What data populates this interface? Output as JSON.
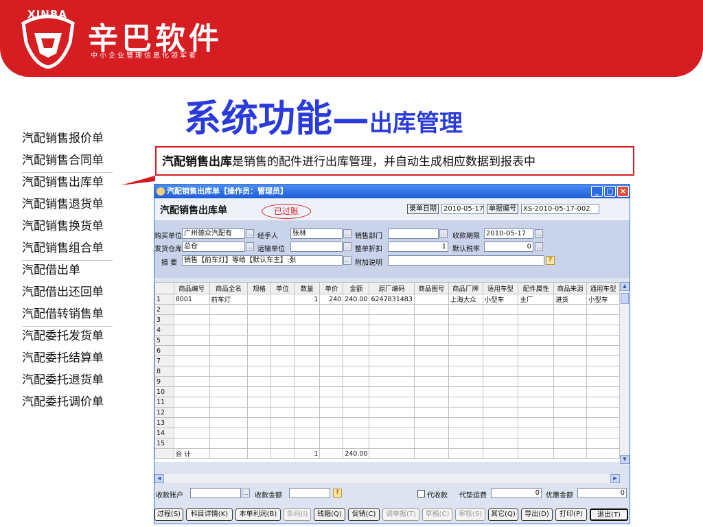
{
  "brand": {
    "badge": "XINBA",
    "name": "辛巴软件",
    "tagline": "中小企业管理信息化领军者"
  },
  "slide": {
    "title": "系统功能—",
    "title_sub": "出库管理"
  },
  "menu": [
    {
      "label": "汽配销售报价单"
    },
    {
      "label": "汽配销售合同单"
    },
    {
      "label": "汽配销售出库单"
    },
    {
      "label": "汽配销售退货单"
    },
    {
      "label": "汽配销售换货单"
    },
    {
      "label": "汽配销售组合单"
    },
    {
      "label": "汽配借出单"
    },
    {
      "label": "汽配借出还回单"
    },
    {
      "label": "汽配借转销售单"
    },
    {
      "label": "汽配委托发货单"
    },
    {
      "label": "汽配委托结算单"
    },
    {
      "label": "汽配委托退货单"
    },
    {
      "label": "汽配委托调价单"
    }
  ],
  "callout": {
    "bold": "汽配销售出库",
    "text": "是销售的配件进行出库管理，并自动生成相应数据到报表中"
  },
  "window": {
    "title": "汽配销售出库单【操作员：管理员】",
    "form_title": "汽配销售出库单",
    "stamp": "已过账",
    "entry_date_label": "录单日期",
    "entry_date": "2010-05-17",
    "doc_no_label": "单据编号",
    "doc_no": "XS-2010-05-17-002",
    "fields": {
      "buyer_label": "购买单位",
      "buyer": "广州德众汽配有",
      "handler_label": "经手人",
      "handler": "张林",
      "dept_label": "销售部门",
      "dept": "",
      "due_label": "收款期限",
      "due": "2010-05-17",
      "warehouse_label": "发货仓库",
      "warehouse": "总仓",
      "carrier_label": "运输单位",
      "carrier": "",
      "discount_label": "整单折扣",
      "discount": "1",
      "tax_label": "默认税率",
      "tax": "0",
      "summary_label": "摘    要",
      "summary": "销售【前车灯】等给【默认车主】:张",
      "note_label": "附加说明",
      "note": ""
    }
  },
  "table": {
    "headers": [
      "",
      "商品编号",
      "商品全名",
      "规格",
      "单位",
      "数量",
      "单价",
      "金额",
      "原厂编码",
      "商品图号",
      "商品厂牌",
      "适用车型",
      "配件属性",
      "商品来源",
      "通用车型"
    ],
    "rows": [
      [
        "1",
        "8001",
        "前车灯",
        "",
        "",
        "1",
        "240",
        "240.00",
        "6247831483",
        "",
        "上海大众",
        "小型车",
        "主厂",
        "进货",
        "小型车"
      ],
      [
        "2",
        "",
        "",
        "",
        "",
        "",
        "",
        "",
        "",
        "",
        "",
        "",
        "",
        "",
        ""
      ],
      [
        "3",
        "",
        "",
        "",
        "",
        "",
        "",
        "",
        "",
        "",
        "",
        "",
        "",
        "",
        ""
      ],
      [
        "4",
        "",
        "",
        "",
        "",
        "",
        "",
        "",
        "",
        "",
        "",
        "",
        "",
        "",
        ""
      ],
      [
        "5",
        "",
        "",
        "",
        "",
        "",
        "",
        "",
        "",
        "",
        "",
        "",
        "",
        "",
        ""
      ],
      [
        "6",
        "",
        "",
        "",
        "",
        "",
        "",
        "",
        "",
        "",
        "",
        "",
        "",
        "",
        ""
      ],
      [
        "7",
        "",
        "",
        "",
        "",
        "",
        "",
        "",
        "",
        "",
        "",
        "",
        "",
        "",
        ""
      ],
      [
        "8",
        "",
        "",
        "",
        "",
        "",
        "",
        "",
        "",
        "",
        "",
        "",
        "",
        "",
        ""
      ],
      [
        "9",
        "",
        "",
        "",
        "",
        "",
        "",
        "",
        "",
        "",
        "",
        "",
        "",
        "",
        ""
      ],
      [
        "10",
        "",
        "",
        "",
        "",
        "",
        "",
        "",
        "",
        "",
        "",
        "",
        "",
        "",
        ""
      ],
      [
        "11",
        "",
        "",
        "",
        "",
        "",
        "",
        "",
        "",
        "",
        "",
        "",
        "",
        "",
        ""
      ],
      [
        "12",
        "",
        "",
        "",
        "",
        "",
        "",
        "",
        "",
        "",
        "",
        "",
        "",
        "",
        ""
      ],
      [
        "13",
        "",
        "",
        "",
        "",
        "",
        "",
        "",
        "",
        "",
        "",
        "",
        "",
        "",
        ""
      ],
      [
        "14",
        "",
        "",
        "",
        "",
        "",
        "",
        "",
        "",
        "",
        "",
        "",
        "",
        "",
        ""
      ],
      [
        "15",
        "",
        "",
        "",
        "",
        "",
        "",
        "",
        "",
        "",
        "",
        "",
        "",
        "",
        ""
      ]
    ],
    "total": [
      "",
      "合  计",
      "",
      "",
      "",
      "1",
      "",
      "240.00",
      "",
      "",
      "",
      "",
      "",
      "",
      ""
    ]
  },
  "bottom": {
    "account_label": "收款账户",
    "account": "",
    "amount_label": "收款金额",
    "amount": "",
    "cod_label": "代收款",
    "freight_label": "代垫运费",
    "freight": "0",
    "benefit_label": "优惠金额",
    "benefit": "0"
  },
  "buttons": [
    {
      "label": "过程(S)",
      "disabled": false
    },
    {
      "label": "科目详情(K)",
      "disabled": false
    },
    {
      "label": "本单利润(B)",
      "disabled": false
    },
    {
      "label": "条码(I)",
      "disabled": true
    },
    {
      "label": "钱箱(Q)",
      "disabled": false
    },
    {
      "label": "促销(C)",
      "disabled": false
    },
    {
      "label": "调单据(T)",
      "disabled": true
    },
    {
      "label": "草稿(C)",
      "disabled": true
    },
    {
      "label": "审核(S)",
      "disabled": true
    },
    {
      "label": "其它(Q)",
      "disabled": false
    },
    {
      "label": "导出(D)",
      "disabled": false
    },
    {
      "label": "打印(P)",
      "disabled": false
    },
    {
      "label": "退出(T)",
      "disabled": false
    }
  ],
  "colors": {
    "brand_red": "#d51d22",
    "title_blue": "#2a3bdc",
    "window_blue": "#1d5ed8"
  }
}
